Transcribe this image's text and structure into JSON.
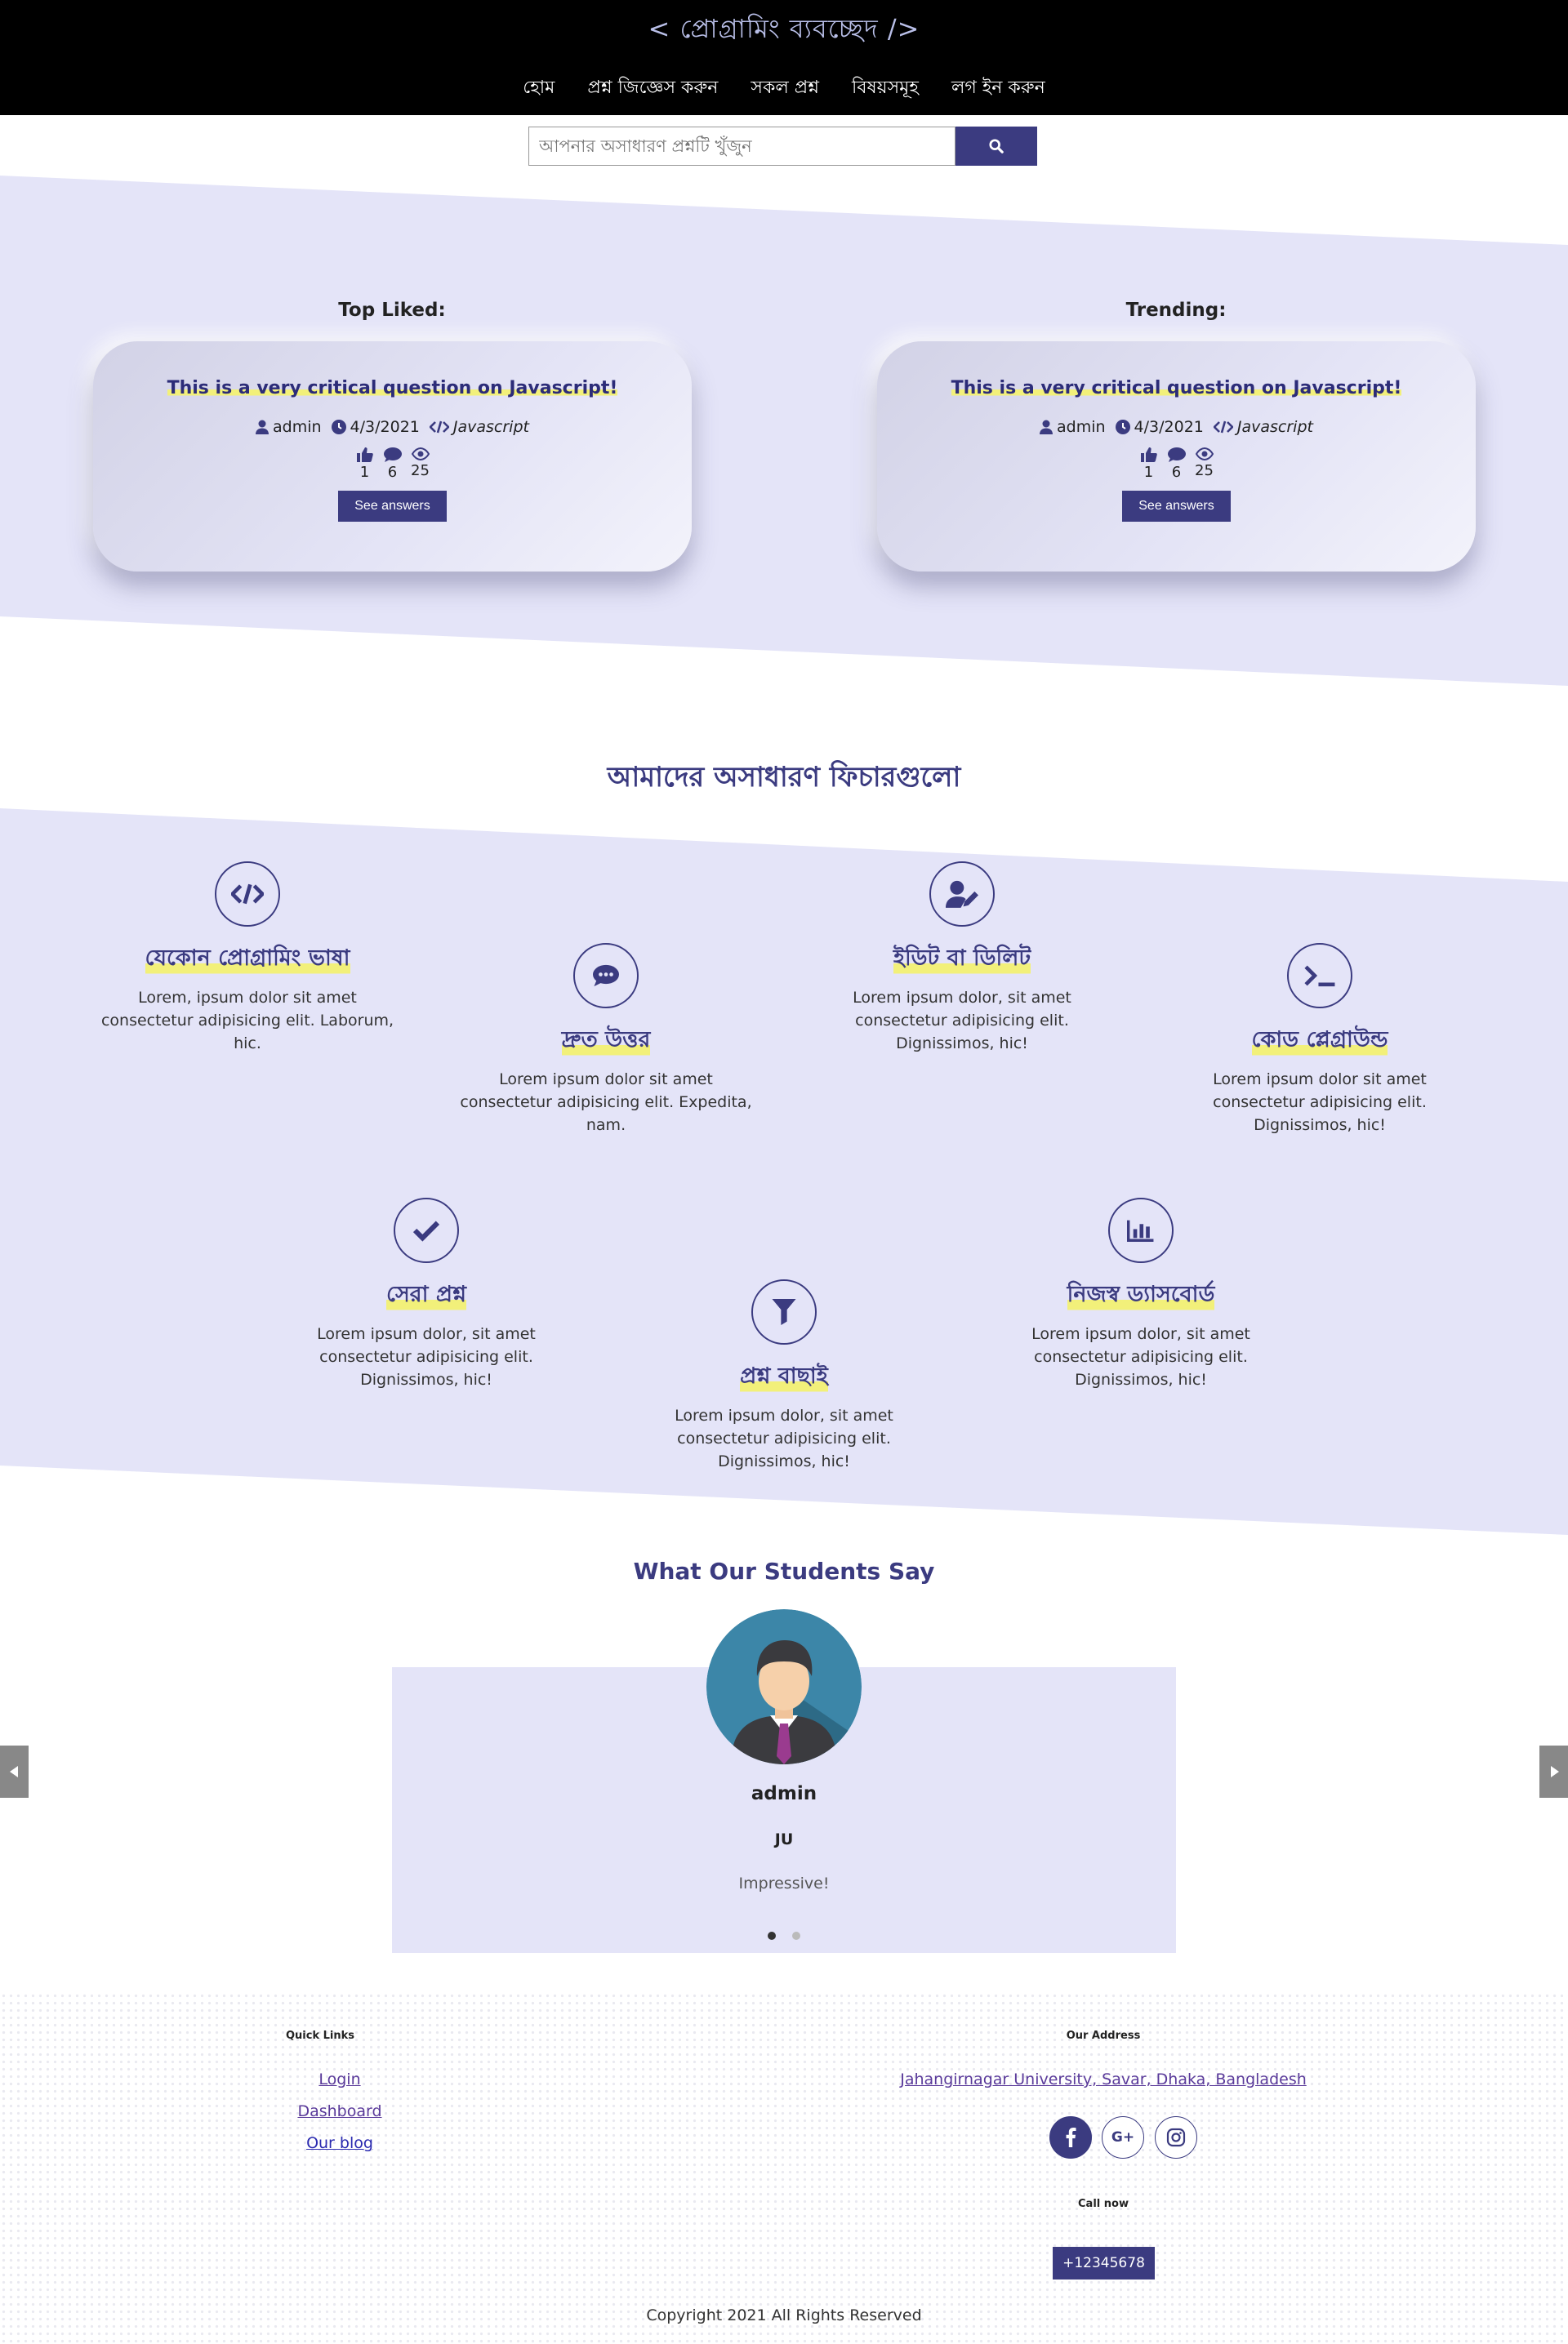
{
  "header": {
    "brand": "< প্রোগ্রামিং  ব্যবচ্ছেদ />",
    "nav": [
      "হোম",
      "প্রশ্ন জিজ্ঞেস করুন",
      "সকল প্রশ্ন",
      "বিষয়সমূহ",
      "লগ ইন করুন"
    ]
  },
  "search": {
    "placeholder": "আপনার অসাধারণ প্রশ্নটি খুঁজুন",
    "button_icon": "search-icon"
  },
  "top_liked": {
    "heading": "Top Liked:",
    "question": "This is a very critical question on Javascript!",
    "author": "admin",
    "date": "4/3/2021",
    "tag": "Javascript",
    "likes": "1",
    "comments": "6",
    "views": "25",
    "button": "See answers"
  },
  "trending": {
    "heading": "Trending:",
    "question": "This is a very critical question on Javascript!",
    "author": "admin",
    "date": "4/3/2021",
    "tag": "Javascript",
    "likes": "1",
    "comments": "6",
    "views": "25",
    "button": "See answers"
  },
  "features": {
    "title": "আমাদের অসাধারণ ফিচারগুলো",
    "items": [
      {
        "icon": "code-icon",
        "name": "যেকোন প্রোগ্রামিং ভাষা",
        "desc": "Lorem, ipsum dolor sit amet consectetur adipisicing elit. Laborum, hic."
      },
      {
        "icon": "comment-dots-icon",
        "name": "দ্রুত উত্তর",
        "desc": "Lorem ipsum dolor sit amet consectetur adipisicing elit. Expedita, nam."
      },
      {
        "icon": "user-edit-icon",
        "name": "ইডিট বা ডিলিট",
        "desc": "Lorem ipsum dolor, sit amet consectetur adipisicing elit. Dignissimos, hic!"
      },
      {
        "icon": "terminal-icon",
        "name": "কোড প্লেগ্রাউন্ড",
        "desc": "Lorem ipsum dolor sit amet consectetur adipisicing elit. Dignissimos, hic!"
      },
      {
        "icon": "check-icon",
        "name": "সেরা প্রশ্ন",
        "desc": "Lorem ipsum dolor, sit amet consectetur adipisicing elit. Dignissimos, hic!"
      },
      {
        "icon": "filter-icon",
        "name": "প্রশ্ন বাছাই",
        "desc": "Lorem ipsum dolor, sit amet consectetur adipisicing elit. Dignissimos, hic!"
      },
      {
        "icon": "chart-bar-icon",
        "name": "নিজস্ব ড্যাসবোর্ড",
        "desc": "Lorem ipsum dolor, sit amet consectetur adipisicing elit. Dignissimos, hic!"
      }
    ]
  },
  "testimonials": {
    "title": "What Our Students Say",
    "name": "admin",
    "org": "JU",
    "quote": "Impressive!",
    "slides": 2,
    "active_slide": 1
  },
  "footer": {
    "quick_links_heading": "Quick Links",
    "links": [
      "Login",
      "Dashboard",
      "Our blog"
    ],
    "address_heading": "Our Address",
    "address": "Jahangirnagar University, Savar, Dhaka, Bangladesh",
    "socials": [
      "facebook-icon",
      "google-plus-icon",
      "instagram-icon"
    ],
    "call_heading": "Call now",
    "phone": "+12345678",
    "copyright": "Copyright 2021 All Rights Reserved"
  },
  "colors": {
    "primary": "#3b3b80",
    "band": "#e4e4f8",
    "highlight": "#f2f07a",
    "header_bg": "#000000"
  }
}
